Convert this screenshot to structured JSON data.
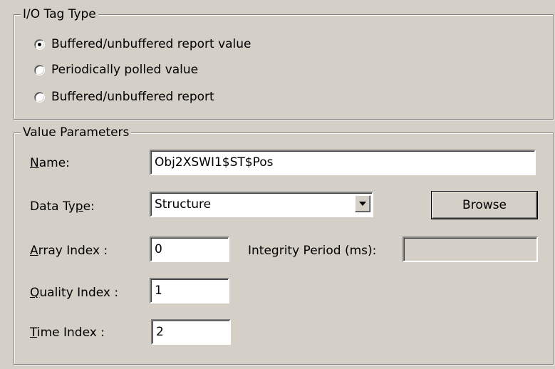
{
  "io_tag_type": {
    "title": "I/O Tag Type",
    "options": [
      {
        "label": "Buffered/unbuffered report value",
        "selected": true
      },
      {
        "label": "Periodically polled value",
        "selected": false
      },
      {
        "label": "Buffered/unbuffered report",
        "selected": false
      }
    ]
  },
  "value_parameters": {
    "title": "Value Parameters",
    "name": {
      "label_mnemonic": "N",
      "label_rest": "ame:",
      "value": "Obj2XSWI1$ST$Pos"
    },
    "data_type": {
      "label_pre": "Data Ty",
      "label_mnemonic": "p",
      "label_post": "e:",
      "value": "Structure"
    },
    "browse_label": "Browse",
    "array_index": {
      "label_mnemonic": "A",
      "label_rest": "rray Index :",
      "value": "0"
    },
    "integrity_period": {
      "label": "Integrity Period (ms):",
      "value": ""
    },
    "quality_index": {
      "label_mnemonic": "Q",
      "label_rest": "uality Index :",
      "value": "1"
    },
    "time_index": {
      "label_mnemonic": "T",
      "label_rest": "ime Index :",
      "value": "2"
    }
  }
}
